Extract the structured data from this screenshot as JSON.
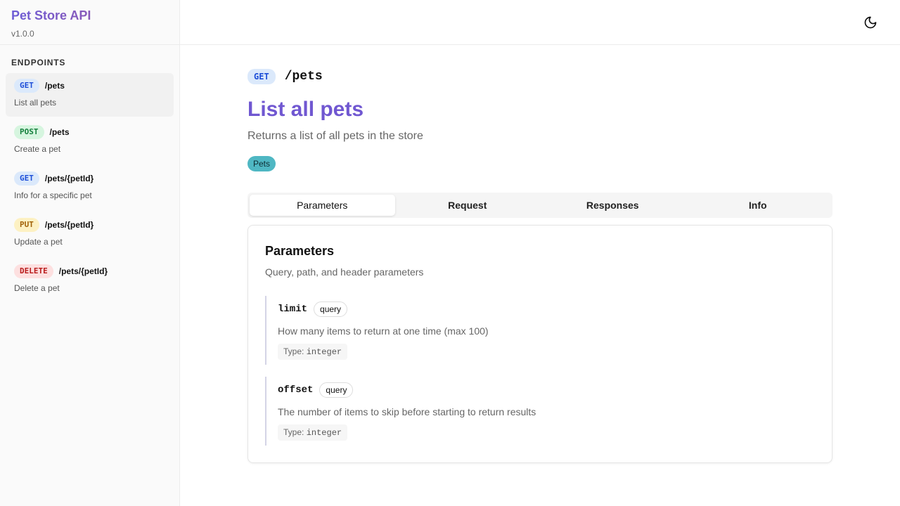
{
  "sidebar": {
    "title": "Pet Store API",
    "version": "v1.0.0",
    "section_label": "ENDPOINTS",
    "endpoints": [
      {
        "method": "GET",
        "path": "/pets",
        "description": "List all pets"
      },
      {
        "method": "POST",
        "path": "/pets",
        "description": "Create a pet"
      },
      {
        "method": "GET",
        "path": "/pets/{petId}",
        "description": "Info for a specific pet"
      },
      {
        "method": "PUT",
        "path": "/pets/{petId}",
        "description": "Update a pet"
      },
      {
        "method": "DELETE",
        "path": "/pets/{petId}",
        "description": "Delete a pet"
      }
    ]
  },
  "topbar": {
    "theme_icon": "moon-icon"
  },
  "endpoint": {
    "method": "GET",
    "path": "/pets",
    "title": "List all pets",
    "description": "Returns a list of all pets in the store",
    "tag": "Pets"
  },
  "tabs": [
    {
      "label": "Parameters",
      "active": true
    },
    {
      "label": "Request",
      "active": false
    },
    {
      "label": "Responses",
      "active": false
    },
    {
      "label": "Info",
      "active": false
    }
  ],
  "parameters_card": {
    "title": "Parameters",
    "subtitle": "Query, path, and header parameters",
    "type_label": "Type:",
    "params": [
      {
        "name": "limit",
        "in": "query",
        "description": "How many items to return at one time (max 100)",
        "type": "integer"
      },
      {
        "name": "offset",
        "in": "query",
        "description": "The number of items to skip before starting to return results",
        "type": "integer"
      }
    ]
  },
  "colors": {
    "title_accent": "#7057d1",
    "tag_bg": "#4fb7c3",
    "get": "#1d4ed8",
    "post": "#15803d",
    "put": "#a16207",
    "delete": "#b91c1c"
  }
}
